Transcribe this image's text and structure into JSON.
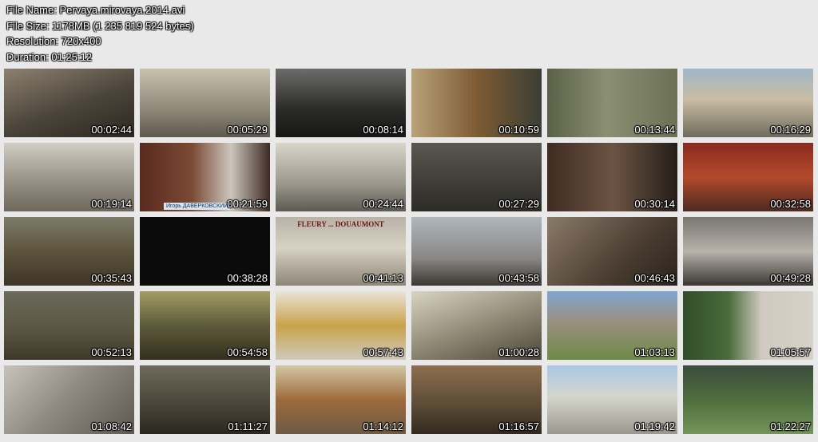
{
  "file_info": {
    "name_line": "File Name: Pervaya.mirovaya.2014.avi",
    "size_line": "File Size: 1178MB (1 235 819 524 bytes)",
    "resolution_line": "Resolution: 720x400",
    "duration_line": "Duration: 01:25:12"
  },
  "thumbnails": [
    {
      "time": "00:02:44",
      "tone": "sepia1"
    },
    {
      "time": "00:05:29",
      "tone": "sepia2"
    },
    {
      "time": "00:08:14",
      "tone": "bw1"
    },
    {
      "time": "00:10:59",
      "tone": "color1"
    },
    {
      "time": "00:13:44",
      "tone": "forest"
    },
    {
      "time": "00:16:29",
      "tone": "street"
    },
    {
      "time": "00:19:14",
      "tone": "cath"
    },
    {
      "time": "00:21:59",
      "tone": "office",
      "caption": "Игорь ДАВЕРКОВСКИЙ"
    },
    {
      "time": "00:24:44",
      "tone": "camp"
    },
    {
      "time": "00:27:29",
      "tone": "parade"
    },
    {
      "time": "00:30:14",
      "tone": "study"
    },
    {
      "time": "00:32:58",
      "tone": "hall"
    },
    {
      "time": "00:35:43",
      "tone": "trench"
    },
    {
      "time": "00:38:28",
      "tone": "black"
    },
    {
      "time": "00:41:13",
      "tone": "monu",
      "plaque": "FLEURY ... DOUAUMONT"
    },
    {
      "time": "00:43:58",
      "tone": "memor"
    },
    {
      "time": "00:46:43",
      "tone": "pen"
    },
    {
      "time": "00:49:28",
      "tone": "crowd"
    },
    {
      "time": "00:52:13",
      "tone": "officer"
    },
    {
      "time": "00:54:58",
      "tone": "trench2"
    },
    {
      "time": "00:57:43",
      "tone": "palace"
    },
    {
      "time": "01:00:28",
      "tone": "field"
    },
    {
      "time": "01:03:13",
      "tone": "fort"
    },
    {
      "time": "01:05:57",
      "tone": "house"
    },
    {
      "time": "01:08:42",
      "tone": "aerial"
    },
    {
      "time": "01:11:27",
      "tone": "ruin"
    },
    {
      "time": "01:14:12",
      "tone": "corr"
    },
    {
      "time": "01:16:57",
      "tone": "dugout"
    },
    {
      "time": "01:19:42",
      "tone": "colon"
    },
    {
      "time": "01:22:27",
      "tone": "grave"
    }
  ]
}
